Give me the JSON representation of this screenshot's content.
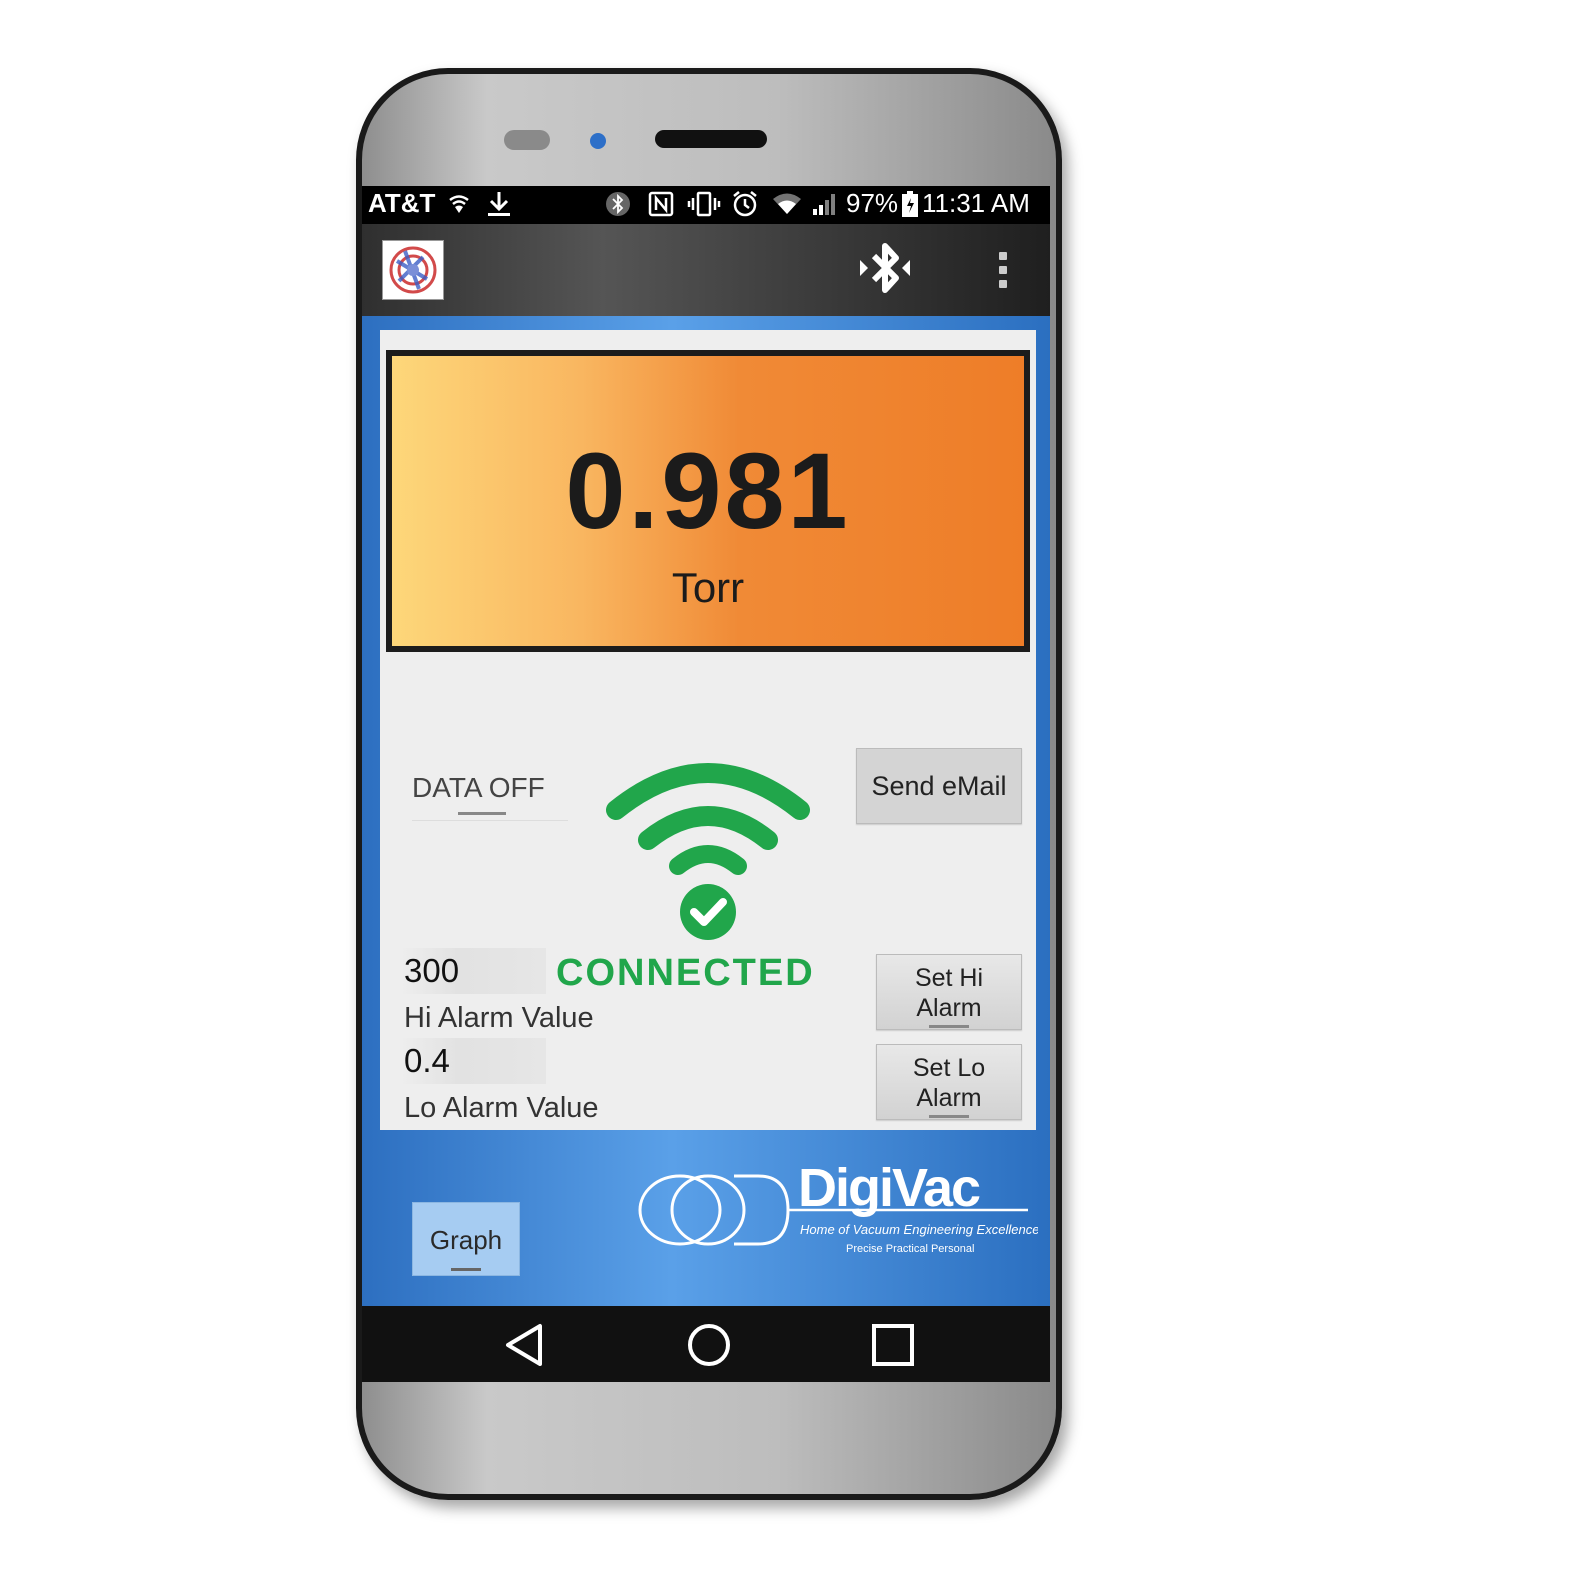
{
  "status_bar": {
    "carrier": "AT&T",
    "battery": "97%",
    "time": "11:31 AM",
    "icons": [
      "wifi-hotspot-icon",
      "download-icon",
      "bluetooth-icon",
      "nfc-icon",
      "vibrate-icon",
      "alarm-icon",
      "wifi-icon",
      "signal-icon",
      "battery-icon"
    ]
  },
  "app_bar": {
    "icons": [
      "app-logo-icon",
      "bluetooth-icon",
      "overflow-menu-icon"
    ]
  },
  "reading": {
    "value": "0.981",
    "unit": "Torr"
  },
  "data_toggle": {
    "label": "DATA OFF"
  },
  "email_button": "Send eMail",
  "connection": {
    "status": "CONNECTED"
  },
  "hi_alarm": {
    "value": "300",
    "label": "Hi Alarm Value",
    "button_line1": "Set Hi",
    "button_line2": "Alarm"
  },
  "lo_alarm": {
    "value": "0.4",
    "label": "Lo Alarm Value",
    "button_line1": "Set Lo",
    "button_line2": "Alarm"
  },
  "graph_button": "Graph",
  "brand": {
    "name": "DigiVac",
    "tagline": "Home of Vacuum Engineering Excellence",
    "motto": "Precise  Practical  Personal"
  },
  "colors": {
    "connected_green": "#21a64b",
    "reading_orange": "#ee7d28",
    "brand_blue": "#2d6fc0"
  }
}
